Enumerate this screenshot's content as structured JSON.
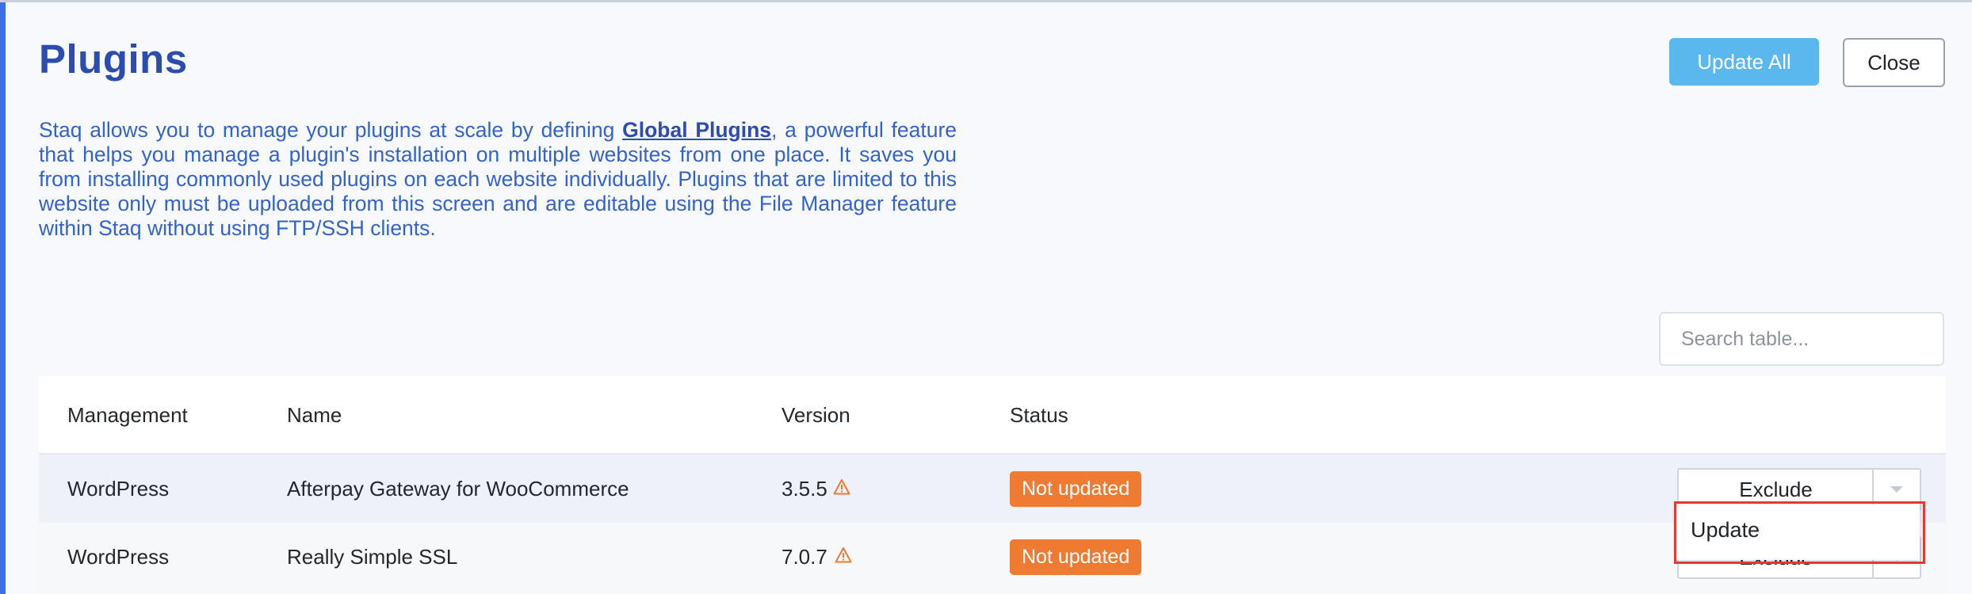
{
  "header": {
    "title": "Plugins",
    "update_all_label": "Update All",
    "close_label": "Close"
  },
  "intro": {
    "before_link": "Staq allows you to manage your plugins at scale by defining ",
    "link_text": "Global Plugins",
    "after_link": ", a powerful feature that helps you manage a plugin's installation on multiple websites from one place. It saves you from installing commonly used plugins on each website individually. Plugins that are limited to this website only must be uploaded from this screen and are editable using the File Manager feature within Staq without using FTP/SSH clients."
  },
  "search": {
    "placeholder": "Search table...",
    "value": ""
  },
  "table": {
    "columns": [
      "Management",
      "Name",
      "Version",
      "Status"
    ],
    "rows": [
      {
        "management": "WordPress",
        "name": "Afterpay Gateway for WooCommerce",
        "version": "3.5.5",
        "version_icon": "warning-icon",
        "status": "Not updated",
        "action": "Exclude"
      },
      {
        "management": "WordPress",
        "name": "Really Simple SSL",
        "version": "7.0.7",
        "version_icon": "warning-icon",
        "status": "Not updated",
        "action": "Exclude"
      }
    ]
  },
  "dropdown": {
    "open_item": "Update"
  },
  "colors": {
    "title": "#2c4cae",
    "intro_text": "#3363c9",
    "primary_button": "#5ab8ee",
    "status_badge": "#ef7b32",
    "warning_icon": "#ef7b32",
    "highlight": "#e23a30",
    "left_accent": "#3d6ee6"
  }
}
